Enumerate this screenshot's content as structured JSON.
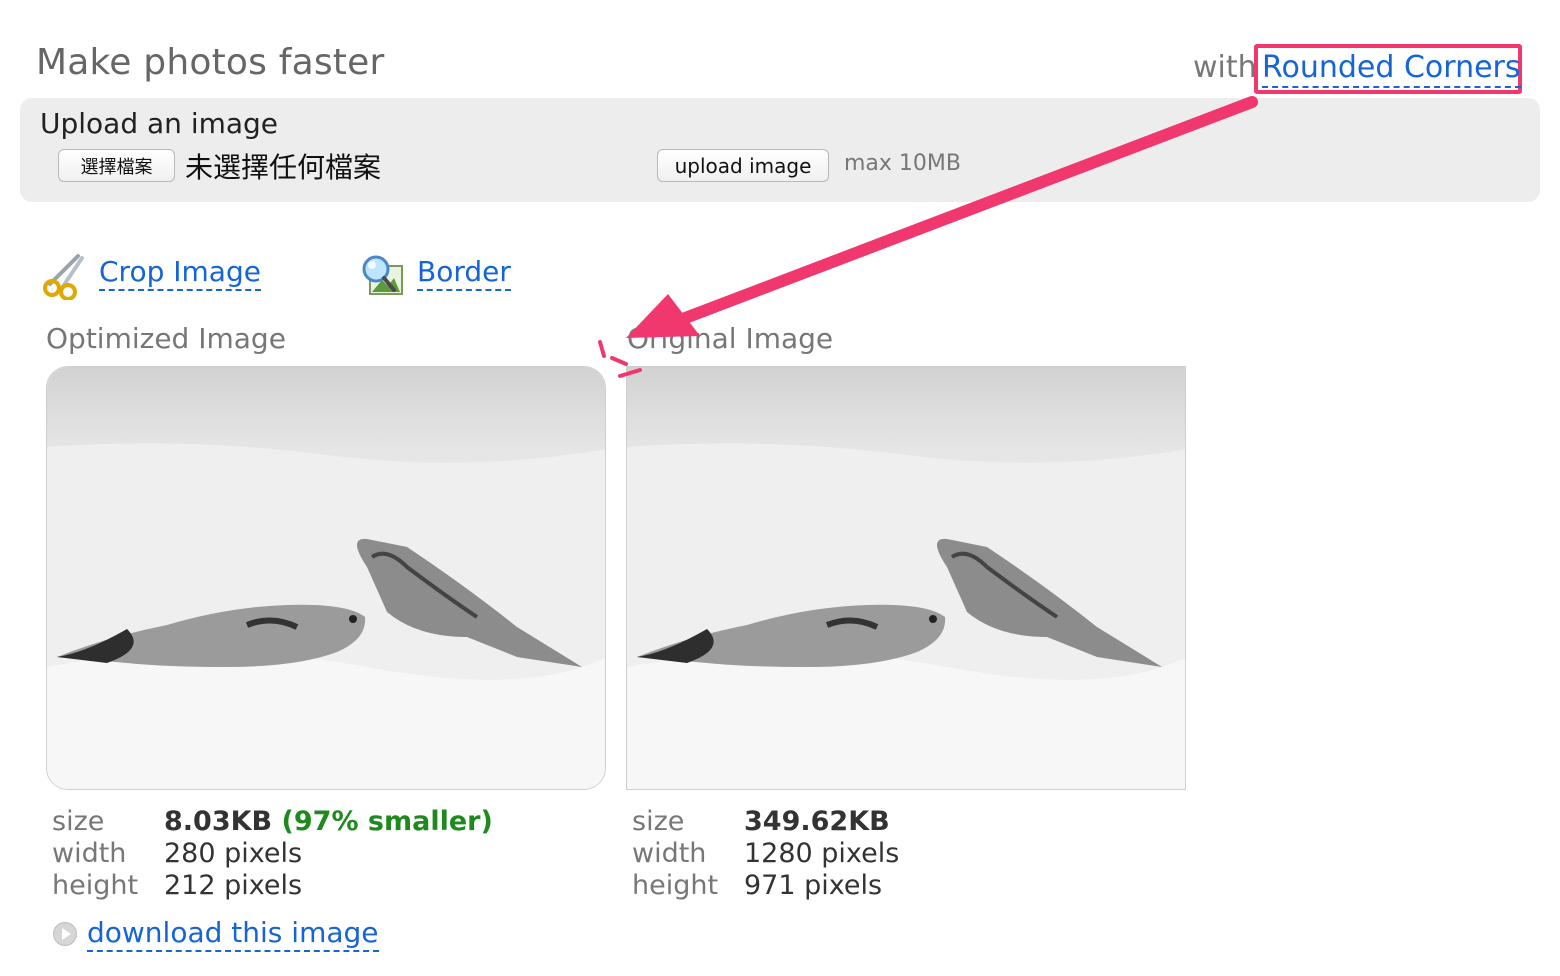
{
  "header": {
    "title": "Make photos faster",
    "with_text": "with",
    "rounded_corners_link": "Rounded Corners"
  },
  "upload": {
    "label": "Upload an image",
    "choose_button": "選擇檔案",
    "no_file_text": "未選擇任何檔案",
    "upload_button": "upload image",
    "max_size": "max 10MB"
  },
  "tools": {
    "crop_label": "Crop Image",
    "border_label": "Border",
    "crop_icon": "scissors-icon",
    "border_icon": "magnifier-picture-icon"
  },
  "optimized": {
    "title": "Optimized Image",
    "size_label": "size",
    "size_value": "8.03KB",
    "size_savings": "(97% smaller)",
    "width_label": "width",
    "width_value": "280 pixels",
    "height_label": "height",
    "height_value": "212 pixels",
    "download_label": "download this image",
    "download_icon": "play-circle-icon"
  },
  "original": {
    "title": "Original Image",
    "size_label": "size",
    "size_value": "349.62KB",
    "width_label": "width",
    "width_value": "1280 pixels",
    "height_label": "height",
    "height_value": "971 pixels"
  },
  "colors": {
    "link": "#1565d8",
    "highlight": "#f0386e",
    "savings": "#1e8a1e",
    "panel": "#ededed"
  }
}
